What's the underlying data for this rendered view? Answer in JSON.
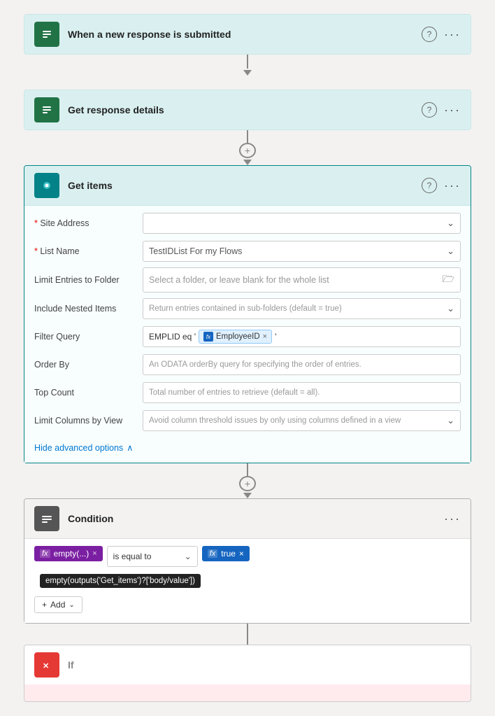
{
  "steps": {
    "step1": {
      "title": "When a new response is submitted",
      "icon_label": "F",
      "icon_type": "forms"
    },
    "step2": {
      "title": "Get response details",
      "icon_label": "F",
      "icon_type": "forms"
    },
    "step3": {
      "title": "Get items",
      "icon_label": "S",
      "icon_type": "sharepoint",
      "fields": {
        "site_address": {
          "label": "* Site Address",
          "placeholder": "",
          "type": "dropdown",
          "value": ""
        },
        "list_name": {
          "label": "* List Name",
          "value": "TestIDList For my Flows",
          "type": "dropdown"
        },
        "limit_to_folder": {
          "label": "Limit Entries to Folder",
          "placeholder": "Select a folder, or leave blank for the whole list",
          "type": "folder"
        },
        "nested_items": {
          "label": "Include Nested Items",
          "placeholder": "Return entries contained in sub-folders (default = true)",
          "type": "dropdown"
        },
        "filter_query": {
          "label": "Filter Query",
          "prefix": "EMPLID eq '",
          "tag_label": "EmployeeID",
          "suffix": "'"
        },
        "order_by": {
          "label": "Order By",
          "placeholder": "An ODATA orderBy query for specifying the order of entries."
        },
        "top_count": {
          "label": "Top Count",
          "placeholder": "Total number of entries to retrieve (default = all)."
        },
        "limit_columns": {
          "label": "Limit Columns by View",
          "placeholder": "Avoid column threshold issues by only using columns defined in a view",
          "type": "dropdown"
        }
      },
      "hide_advanced": "Hide advanced options"
    },
    "step4": {
      "title": "Condition",
      "icon_label": "≡",
      "icon_type": "condition",
      "cond_left_label": "empty(...)",
      "cond_op": "is equal to",
      "cond_right_label": "true",
      "tooltip": "empty(outputs('Get_items')?['body/value'])",
      "add_label": "Add"
    },
    "step5": {
      "title": "If",
      "icon_type": "if"
    }
  },
  "connectors": {
    "plus": "+",
    "arrow_down": "▼"
  }
}
